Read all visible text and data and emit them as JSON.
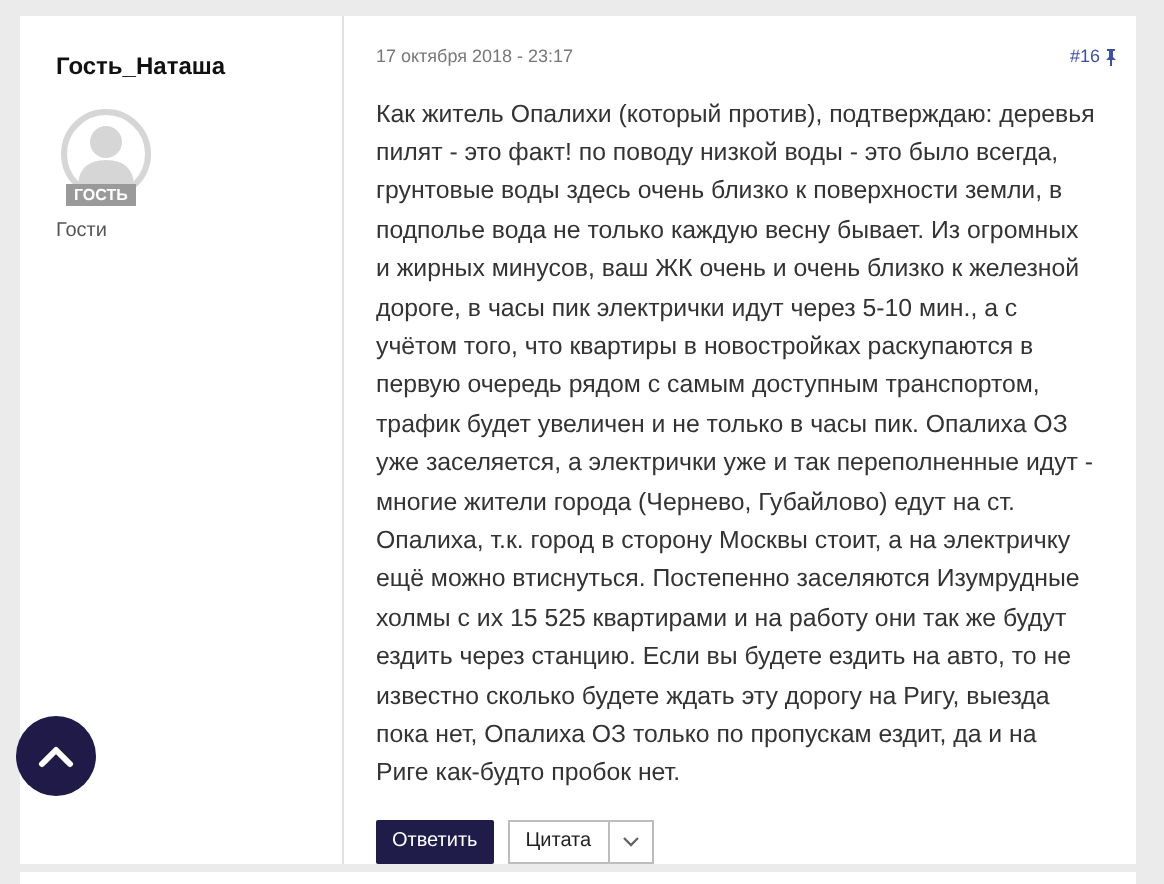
{
  "post": {
    "author": "Гость_Наташа",
    "avatar_badge": "ГОСТЬ",
    "group": "Гости",
    "date": "17 октября 2018 - 23:17",
    "number": "#16",
    "text": "Как житель Опалихи (который против), подтверждаю: деревья пилят - это факт! по поводу низкой воды - это было всегда, грунтовые воды здесь очень близко к поверхности земли, в подполье вода не только каждую весну бывает. Из огромных и жирных минусов, ваш ЖК очень и очень близко к железной дороге, в часы пик электрички идут через 5-10 мин., а с учётом того, что квартиры в новостройках раскупаются в первую очередь рядом с самым доступным транспортом, трафик будет увеличен и не только в часы пик. Опалиха ОЗ уже заселяется, а электрички уже и так переполненные идут - многие жители города (Чернево, Губайлово) едут на ст. Опалиха, т.к. город в сторону Москвы стоит, а на электричку ещё можно втиснуться. Постепенно заселяются Изумрудные холмы с их 15 525 квартирами и на работу они так же будут ездить через станцию. Если вы будете ездить на авто, то не известно сколько будете ждать эту дорогу на Ригу, выезда пока нет, Опалиха ОЗ только по пропускам ездит, да и на Риге как-будто пробок нет.",
    "buttons": [
      "Ответить",
      "Цитата"
    ]
  }
}
